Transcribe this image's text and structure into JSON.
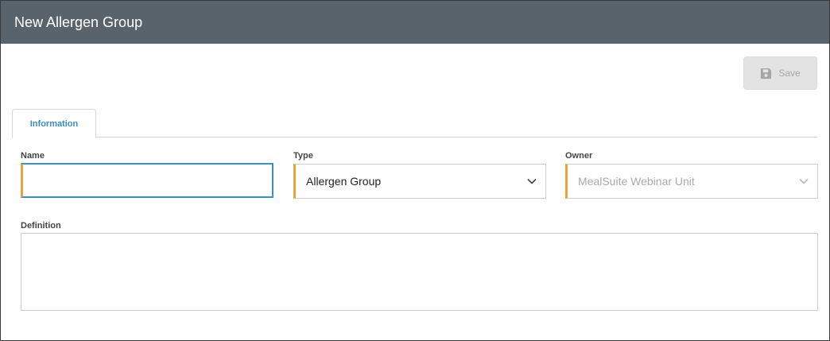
{
  "window": {
    "title": "New Allergen Group"
  },
  "toolbar": {
    "save_label": "Save",
    "save_icon": "floppy-disk-icon"
  },
  "tabs": [
    {
      "label": "Information",
      "active": true
    }
  ],
  "form": {
    "name": {
      "label": "Name",
      "value": "",
      "placeholder": ""
    },
    "type": {
      "label": "Type",
      "value": "Allergen Group"
    },
    "owner": {
      "label": "Owner",
      "value": "MealSuite Webinar Unit",
      "disabled": true
    },
    "definition": {
      "label": "Definition",
      "value": ""
    }
  },
  "colors": {
    "titlebar": "#58636b",
    "accent": "#3b8bc5",
    "required_marker": "#e8a33a"
  }
}
